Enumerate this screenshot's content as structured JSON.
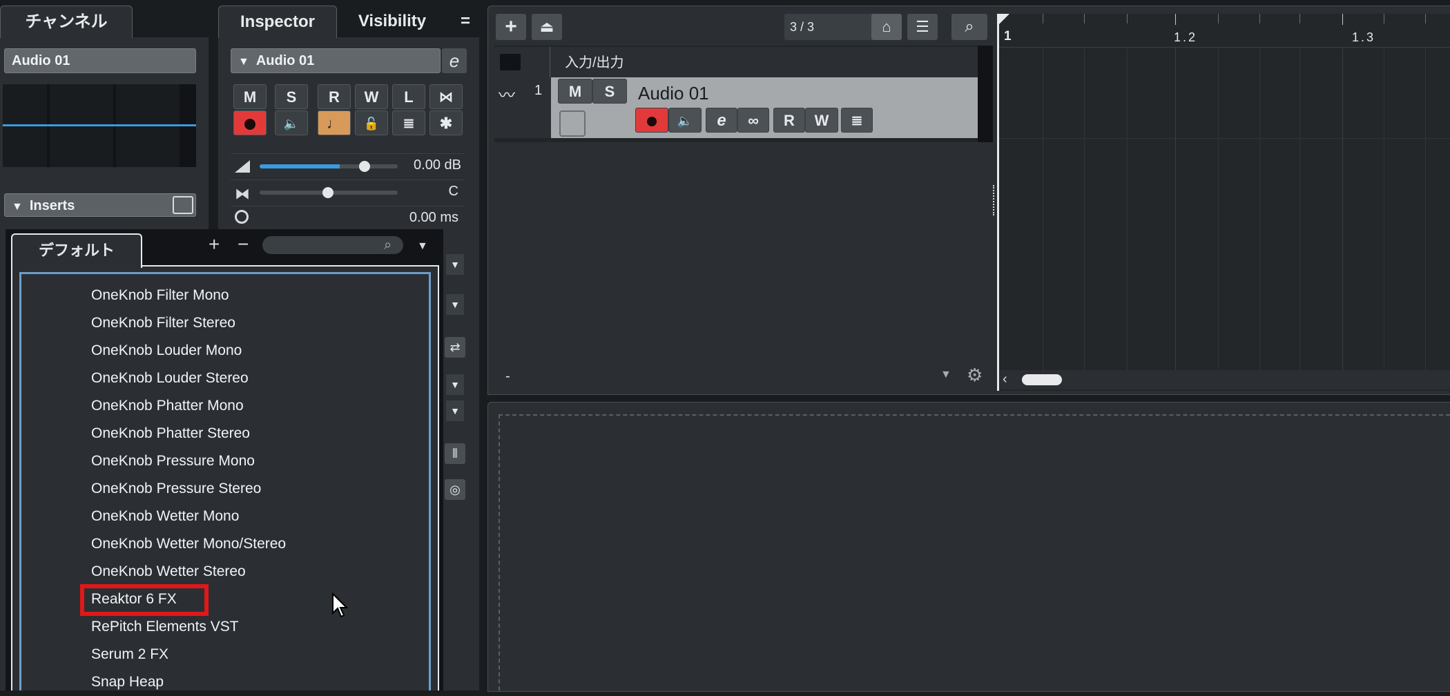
{
  "channel": {
    "tab_label": "チャンネル",
    "name": "Audio 01",
    "inserts_label": "Inserts"
  },
  "inspector": {
    "tabs": [
      "Inspector",
      "Visibility"
    ],
    "menu_icon": "=",
    "track_name": "Audio 01",
    "buttons_row1": [
      "M",
      "S",
      "R",
      "W",
      "L"
    ],
    "volume": "0.00 dB",
    "pan": "C",
    "delay": "0.00 ms"
  },
  "plugin_browser": {
    "tab_label": "デフォルト",
    "add_icon": "+",
    "remove_icon": "−",
    "search_placeholder": "",
    "items": [
      "OneKnob Filter Mono",
      "OneKnob Filter Stereo",
      "OneKnob Louder Mono",
      "OneKnob Louder Stereo",
      "OneKnob Phatter Mono",
      "OneKnob Phatter Stereo",
      "OneKnob Pressure Mono",
      "OneKnob Pressure Stereo",
      "OneKnob Wetter Mono",
      "OneKnob Wetter Mono/Stereo",
      "OneKnob Wetter Stereo",
      "Reaktor 6 FX",
      "RePitch Elements VST",
      "Serum 2 FX",
      "Snap Heap"
    ],
    "highlighted_item": "Reaktor 6 FX",
    "highlight_color": "#e01818"
  },
  "track_list": {
    "counter": "3 / 3",
    "folder_label": "入力/出力",
    "track_number": "1",
    "track_name": "Audio 01",
    "m_label": "M",
    "s_label": "S",
    "r_label": "R",
    "w_label": "W",
    "footer_dash": "-"
  },
  "ruler": {
    "marks": [
      "1",
      "1.2",
      "1.3"
    ]
  },
  "colors": {
    "accent_blue": "#4aa3e6",
    "record_red": "#e23a3a",
    "monitor_orange": "#d89a5a"
  }
}
